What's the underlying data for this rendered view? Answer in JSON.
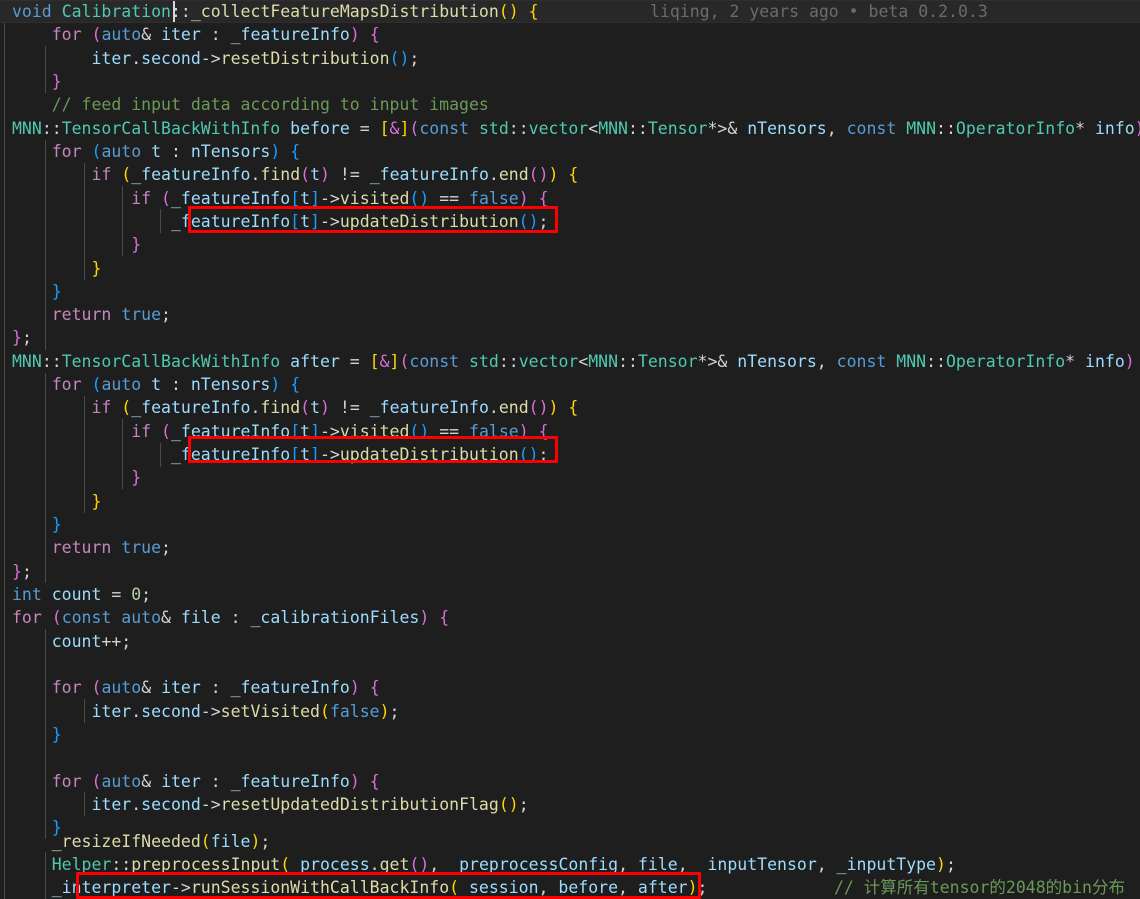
{
  "editor": {
    "theme": "dark-plus",
    "background": "#1e1e1e",
    "current_line_background": "#282828",
    "font_size_px": 16.5,
    "line_height_px": 23.32,
    "caret_color": "#d8d8d8",
    "annotation_box_color": "#ff0000",
    "indent_guide_color": "#5a5a5a"
  },
  "blame": {
    "text": "liqing, 2 years ago • beta 0.2.0.3",
    "color": "#6b6b6b"
  },
  "code": {
    "language": "cpp",
    "lines": [
      "void Calibration::_collectFeatureMapsDistribution() {",
      "    for (auto& iter : _featureInfo) {",
      "        iter.second->resetDistribution();",
      "    }",
      "    // feed input data according to input images",
      "    MNN::TensorCallBackWithInfo before = [&](const std::vector<MNN::Tensor*>& nTensors, const MNN::OperatorInfo* info) {",
      "        for (auto t : nTensors) {",
      "            if (_featureInfo.find(t) != _featureInfo.end()) {",
      "                if (_featureInfo[t]->visited() == false) {",
      "                    _featureInfo[t]->updateDistribution();",
      "                }",
      "            }",
      "        }",
      "        return true;",
      "    };",
      "    MNN::TensorCallBackWithInfo after = [&](const std::vector<MNN::Tensor*>& nTensors, const MNN::OperatorInfo* info) {",
      "        for (auto t : nTensors) {",
      "            if (_featureInfo.find(t) != _featureInfo.end()) {",
      "                if (_featureInfo[t]->visited() == false) {",
      "                    _featureInfo[t]->updateDistribution();",
      "                }",
      "            }",
      "        }",
      "        return true;",
      "    };",
      "    int count = 0;",
      "    for (const auto& file : _calibrationFiles) {",
      "        count++;",
      "",
      "        for (auto& iter : _featureInfo) {",
      "            iter.second->setVisited(false);",
      "        }",
      "",
      "        for (auto& iter : _featureInfo) {",
      "            iter.second->resetUpdatedDistributionFlag();",
      "        }",
      "        _resizeIfNeeded(file);",
      "        Helper::preprocessInput( process.get(),  preprocessConfig, file,  inputTensor, _inputType);",
      "        _interpreter->runSessionWithCallBackInfo(_session, before, after);"
    ]
  },
  "comment_cn": {
    "text": "// 计算所有tensor的2048的bin分布",
    "color": "#6a9955"
  },
  "annotations": [
    {
      "label": "updateDistribution-call-before",
      "target_text": "_featureInfo[t]->updateDistribution();"
    },
    {
      "label": "updateDistribution-call-after",
      "target_text": "_featureInfo[t]->updateDistribution();"
    },
    {
      "label": "runSessionWithCallBackInfo-call",
      "target_text": "_interpreter->runSessionWithCallBackInfo(_session, before, after);"
    }
  ],
  "caret": {
    "line": 1,
    "column": 20,
    "after_text": "void Calibration::"
  }
}
